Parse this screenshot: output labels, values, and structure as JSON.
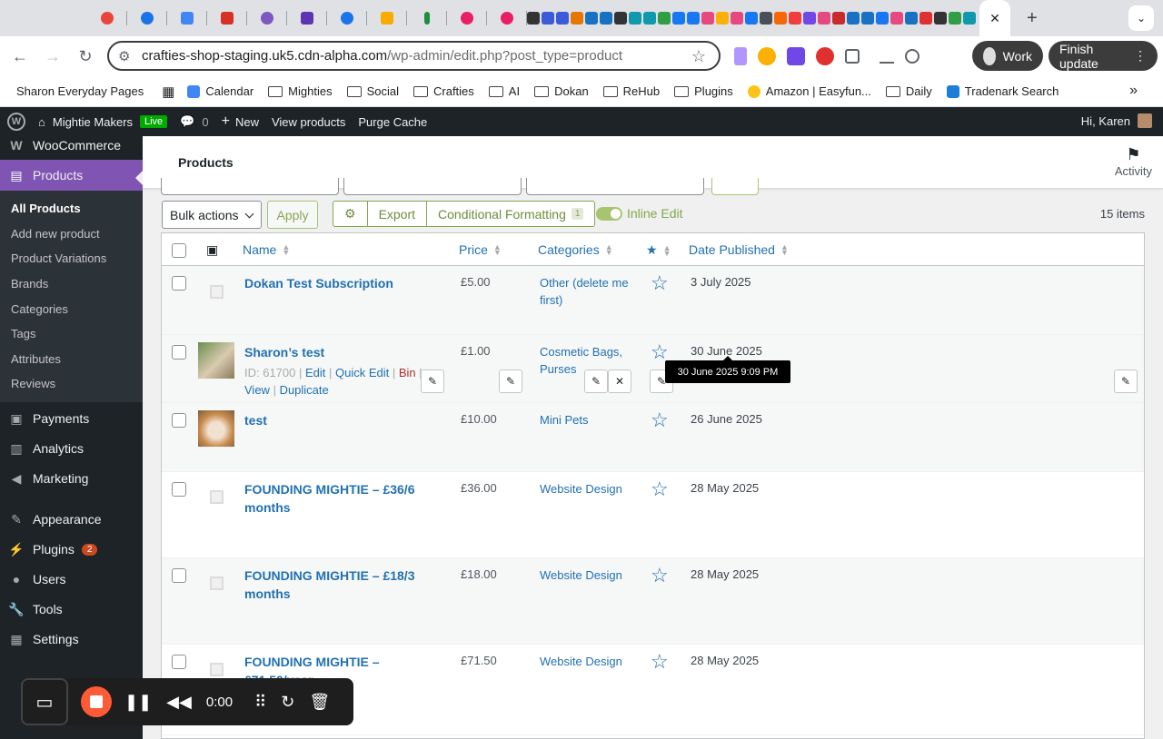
{
  "browser": {
    "url_host": "crafties-shop-staging.uk5.cdn-alpha.com",
    "url_path": "/wp-admin/edit.php?post_type=product",
    "profile_label": "Work",
    "update_label": "Finish update",
    "tab_favicon_colors": [
      "#e8453c",
      "#1a73e8",
      "#4285f4",
      "#d93025",
      "#7e57c2",
      "#5e35b1",
      "#1a73e8",
      "#f9ab00",
      "#1e8e3e",
      "#e91e63",
      "#e91e63"
    ]
  },
  "bookmarks": {
    "first": "Sharon Everyday Pages",
    "items": [
      "Calendar",
      "Mighties",
      "Social",
      "Crafties",
      "AI",
      "Dokan",
      "ReHub",
      "Plugins",
      "Amazon | Easyfun...",
      "Daily",
      "Tradenark Search"
    ]
  },
  "adminbar": {
    "site_name": "Mightie Makers",
    "live": "Live",
    "comments": "0",
    "new": "New",
    "view_products": "View products",
    "purge_cache": "Purge Cache",
    "greeting": "Hi, Karen"
  },
  "sidebar": {
    "woocommerce": "WooCommerce",
    "products": "Products",
    "sub": [
      "All Products",
      "Add new product",
      "Product Variations",
      "Brands",
      "Categories",
      "Tags",
      "Attributes",
      "Reviews"
    ],
    "payments": "Payments",
    "analytics": "Analytics",
    "marketing": "Marketing",
    "appearance": "Appearance",
    "plugins": "Plugins",
    "plugins_badge": "2",
    "users": "Users",
    "tools": "Tools",
    "settings": "Settings"
  },
  "header": {
    "title": "Products",
    "activity": "Activity"
  },
  "actions": {
    "bulk": "Bulk actions",
    "apply": "Apply",
    "export": "Export",
    "conditional": "Conditional Formatting",
    "conditional_count": "1",
    "inline_edit": "Inline Edit",
    "items_count": "15 items"
  },
  "table": {
    "columns": {
      "name": "Name",
      "price": "Price",
      "categories": "Categories",
      "date": "Date Published"
    },
    "rows": [
      {
        "name": "Dokan Test Subscription",
        "price": "£5.00",
        "cats": "Other (delete me first)",
        "date": "3 July 2025"
      },
      {
        "name": "Sharon’s test",
        "price": "£1.00",
        "cats": "Cosmetic Bags, Purses",
        "date": "30 June 2025"
      },
      {
        "name": "test",
        "price": "£10.00",
        "cats": "Mini Pets",
        "date": "26 June 2025"
      },
      {
        "name": "FOUNDING MIGHTIE – £36/6 months",
        "price": "£36.00",
        "cats": "Website Design",
        "date": "28 May 2025"
      },
      {
        "name": "FOUNDING MIGHTIE – £18/3 months",
        "price": "£18.00",
        "cats": "Website Design",
        "date": "28 May 2025"
      },
      {
        "name": "FOUNDING MIGHTIE – £71.50/year",
        "price": "£71.50",
        "cats": "Website Design",
        "date": "28 May 2025"
      }
    ],
    "row_actions": {
      "id": "ID: 61700",
      "edit": "Edit",
      "quick_edit": "Quick Edit",
      "bin": "Bin",
      "view": "View",
      "duplicate": "Duplicate"
    }
  },
  "tooltip": "30 June 2025 9:09 PM",
  "recorder": {
    "time": "0:00"
  }
}
